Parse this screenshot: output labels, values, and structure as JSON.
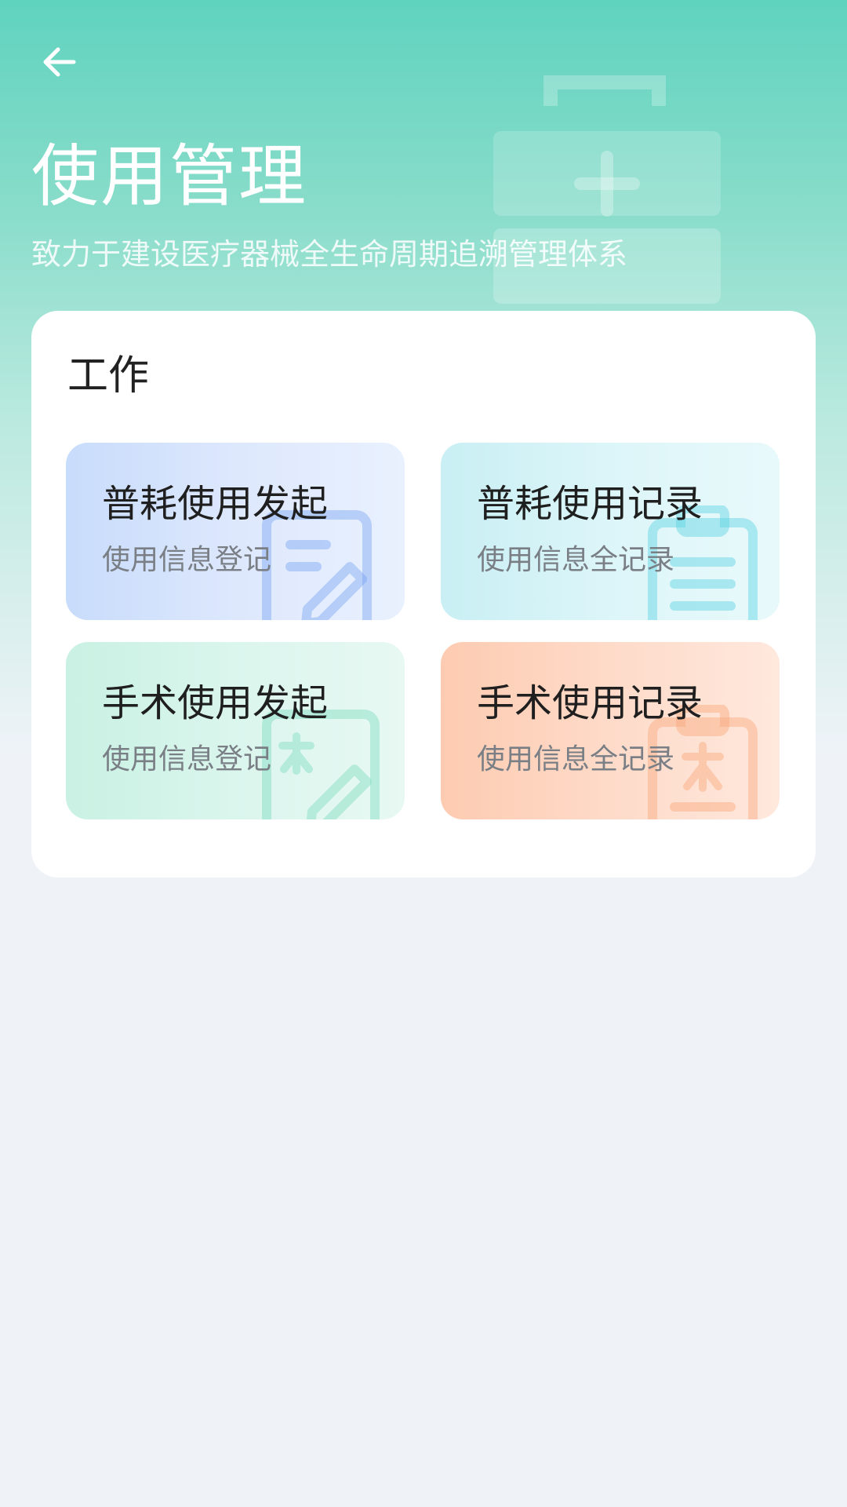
{
  "header": {
    "title": "使用管理",
    "subtitle": "致力于建设医疗器械全生命周期追溯管理体系"
  },
  "icons": {
    "back": "arrow-left-icon",
    "header_illustration": "medical-kit-icon"
  },
  "work": {
    "section_title": "工作",
    "tiles": [
      {
        "title": "普耗使用发起",
        "desc": "使用信息登记",
        "icon": "document-edit-icon",
        "color": "#6f9ef0"
      },
      {
        "title": "普耗使用记录",
        "desc": "使用信息全记录",
        "icon": "clipboard-list-icon",
        "color": "#5ed3e2"
      },
      {
        "title": "手术使用发起",
        "desc": "使用信息登记",
        "icon": "surgery-document-edit-icon",
        "color": "#7fdcbf"
      },
      {
        "title": "手术使用记录",
        "desc": "使用信息全记录",
        "icon": "surgery-clipboard-icon",
        "color": "#f9a97c"
      }
    ]
  },
  "colors": {
    "header_start": "#5fd3bf",
    "page_background": "#eff3f8",
    "card_background": "#ffffff"
  }
}
